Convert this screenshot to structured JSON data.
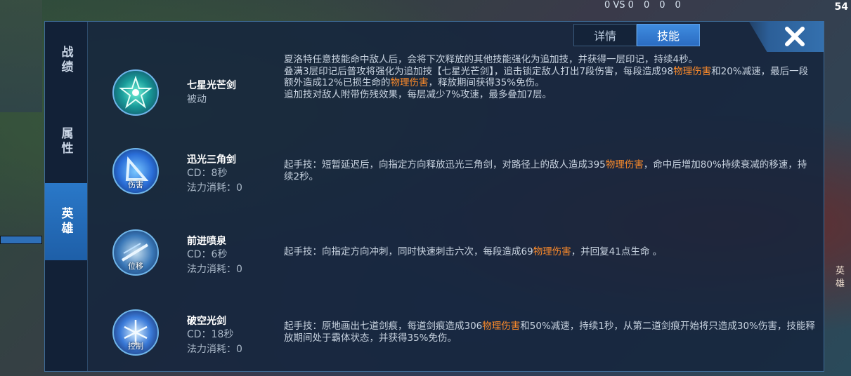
{
  "hud": {
    "vs_label": "0 VS 0",
    "kills": "0",
    "deaths": "0",
    "assists": "0",
    "corner_num": "54",
    "side_label": "英雄"
  },
  "sidebar": {
    "tabs": [
      {
        "label": "战绩",
        "active": false
      },
      {
        "label": "属性",
        "active": false
      },
      {
        "label": "英雄",
        "active": true
      }
    ]
  },
  "tabs": [
    {
      "label": "详情",
      "active": false
    },
    {
      "label": "技能",
      "active": true
    }
  ],
  "colors": {
    "accent": "#2a78c8",
    "highlight": "#ff8c2a",
    "panel": "#16263e"
  },
  "skills": [
    {
      "name": "七星光芒剑",
      "type": "被动",
      "icon": "star-sword-icon",
      "icon_tag": "",
      "desc_1a": "夏洛特任意技能命中敌人后，会将下次释放的其他技能强化为追加技，并获得一层印记，持续4秒。",
      "desc_2a": "叠满3层印记后普攻将强化为追加技【七星光芒剑】，追击锁定敌人打出7段伤害，每段造成98",
      "desc_2b": "物理伤害",
      "desc_2c": "和20%减速，最后一段额外造成12%已损生命的",
      "desc_2d": "物理伤害",
      "desc_2e": "，释放期间获得35%免伤。",
      "desc_3a": "追加技对敌人附带伤残效果，每层减少7%攻速，最多叠加7层。"
    },
    {
      "name": "迅光三角剑",
      "cd": "CD：8秒",
      "mana": "法力消耗：0",
      "icon": "triangle-sword-icon",
      "icon_tag": "伤害",
      "desc_a": "起手技：短暂延迟后，向指定方向释放迅光三角剑，对路径上的敌人造成395",
      "desc_b": "物理伤害",
      "desc_c": "，命中后增加80%持续衰减的移速，持续2秒。"
    },
    {
      "name": "前进喷泉",
      "cd": "CD：6秒",
      "mana": "法力消耗：0",
      "icon": "dash-thrust-icon",
      "icon_tag": "位移",
      "desc_a": "起手技：向指定方向冲刺，同时快速刺击六次，每段造成69",
      "desc_b": "物理伤害",
      "desc_c": "，并回复41点生命 。"
    },
    {
      "name": "破空光剑",
      "cd": "CD：18秒",
      "mana": "法力消耗：0",
      "icon": "sky-break-sword-icon",
      "icon_tag": "控制",
      "desc_a": "起手技：原地画出七道剑痕，每道剑痕造成306",
      "desc_b": "物理伤害",
      "desc_c": "和50%减速，持续1秒，从第二道剑痕开始将只造成30%伤害，技能释放期间处于霸体状态，并获得35%免伤。"
    }
  ]
}
